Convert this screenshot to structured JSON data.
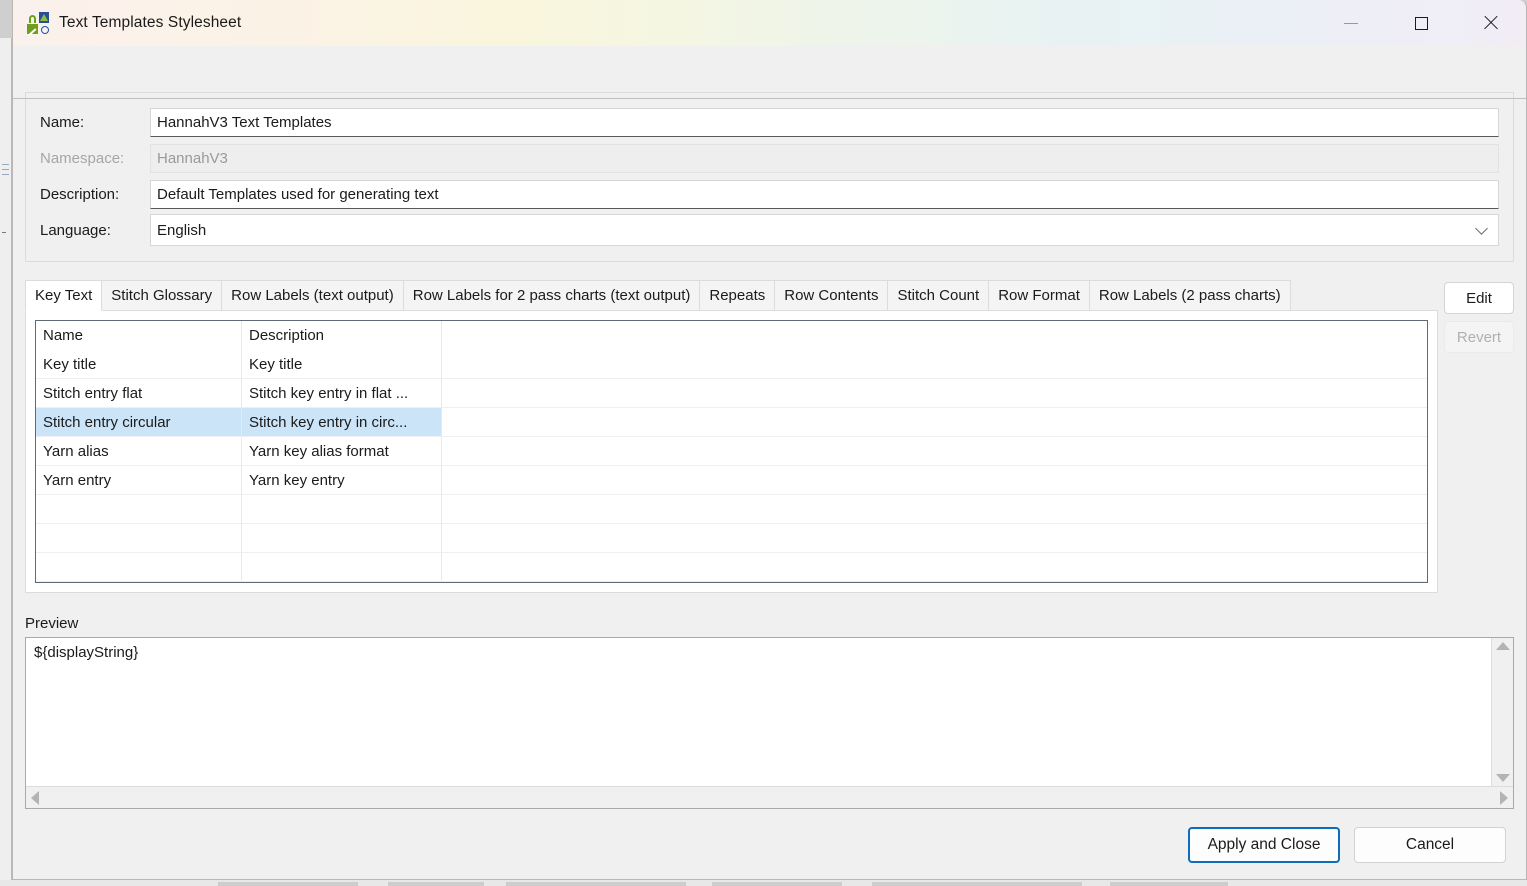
{
  "window": {
    "title": "Text Templates Stylesheet",
    "icon": "stitch-glossary-icon",
    "minimize_label": "Minimize",
    "maximize_label": "Maximize",
    "close_label": "Close"
  },
  "form": {
    "name": {
      "label": "Name:",
      "value": "HannahV3 Text Templates"
    },
    "namespace": {
      "label": "Namespace:",
      "value": "HannahV3",
      "disabled": true
    },
    "description": {
      "label": "Description:",
      "value": "Default Templates used for generating text"
    },
    "language": {
      "label": "Language:",
      "value": "English"
    }
  },
  "tabs": [
    {
      "label": "Key Text",
      "active": true
    },
    {
      "label": "Stitch Glossary",
      "active": false
    },
    {
      "label": "Row Labels (text output)",
      "active": false
    },
    {
      "label": "Row Labels for 2 pass charts (text output)",
      "active": false
    },
    {
      "label": "Repeats",
      "active": false
    },
    {
      "label": "Row Contents",
      "active": false
    },
    {
      "label": "Stitch Count",
      "active": false
    },
    {
      "label": "Row Format",
      "active": false
    },
    {
      "label": "Row Labels (2 pass charts)",
      "active": false
    }
  ],
  "table": {
    "columns": [
      "Name",
      "Description"
    ],
    "rows": [
      {
        "name": "Key title",
        "description": "Key title",
        "selected": false
      },
      {
        "name": "Stitch entry flat",
        "description": "Stitch key entry in flat ...",
        "selected": false
      },
      {
        "name": "Stitch entry circular",
        "description": "Stitch key entry in circ...",
        "selected": true
      },
      {
        "name": "Yarn alias",
        "description": "Yarn key alias format",
        "selected": false
      },
      {
        "name": "Yarn entry",
        "description": "Yarn key entry",
        "selected": false
      },
      {
        "name": "",
        "description": "",
        "selected": false
      },
      {
        "name": "",
        "description": "",
        "selected": false
      },
      {
        "name": "",
        "description": "",
        "selected": false
      }
    ]
  },
  "side_buttons": {
    "edit": {
      "label": "Edit",
      "enabled": true
    },
    "revert": {
      "label": "Revert",
      "enabled": false
    }
  },
  "preview": {
    "label": "Preview",
    "text": "${displayString}"
  },
  "footer": {
    "apply_and_close": "Apply and Close",
    "cancel": "Cancel"
  },
  "colors": {
    "selection_blue": "#cce4f7",
    "default_button_border": "#0f6cbd",
    "icon_green": "#6f9e1f",
    "icon_blue": "#2b4e9b"
  }
}
